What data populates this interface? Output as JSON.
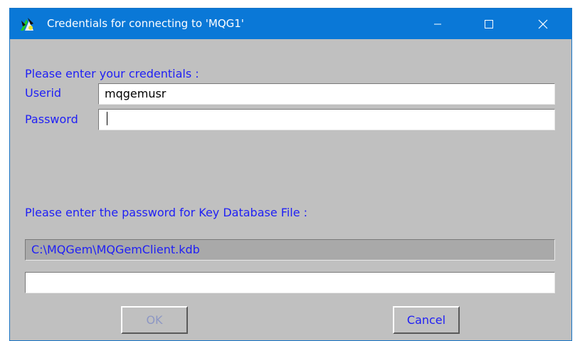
{
  "window": {
    "title": "Credentials for connecting to 'MQG1'",
    "icon": "mqgem-app-icon",
    "controls": [
      "minimize-icon",
      "maximize-icon",
      "close-icon"
    ]
  },
  "credentials": {
    "heading": "Please enter your credentials :",
    "userid_label": "Userid",
    "userid_value": "mqgemusr",
    "password_label": "Password",
    "password_value": ""
  },
  "keydb": {
    "heading": "Please enter the password for Key Database File :",
    "file_path": "C:\\MQGem\\MQGemClient.kdb",
    "password_value": ""
  },
  "buttons": {
    "ok_label": "OK",
    "ok_enabled": false,
    "cancel_label": "Cancel"
  },
  "colors": {
    "titlebar": "#0a78d7",
    "dialog_bg": "#c0c0c0",
    "label_text": "#1f1ff5",
    "readonly_bg": "#a9a9a9"
  }
}
